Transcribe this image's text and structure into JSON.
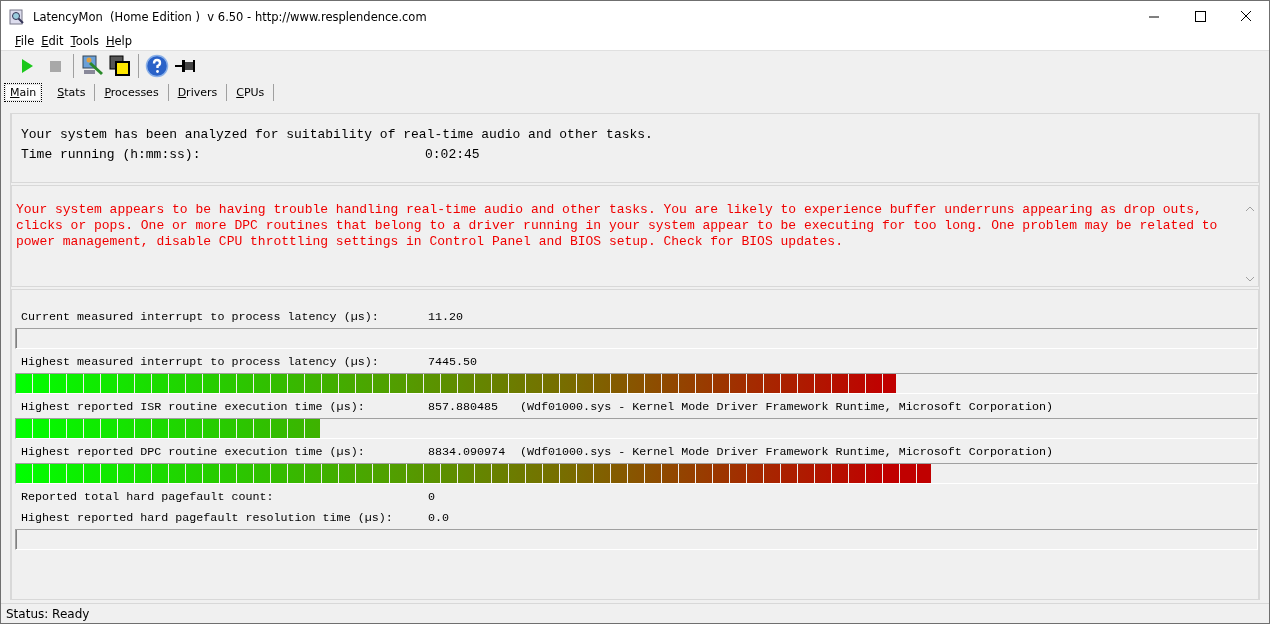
{
  "window": {
    "title": "LatencyMon  (Home Edition )  v 6.50 - http://www.resplendence.com"
  },
  "menu": [
    "File",
    "Edit",
    "Tools",
    "Help"
  ],
  "toolbar": [
    {
      "kind": "play",
      "disabled": false
    },
    {
      "kind": "stop",
      "disabled": true
    },
    {
      "kind": "monitor",
      "disabled": false
    },
    {
      "kind": "windows",
      "disabled": false
    },
    {
      "kind": "help",
      "disabled": false
    },
    {
      "kind": "pin",
      "disabled": false
    }
  ],
  "tabs": [
    {
      "label": "Main",
      "selected": true
    },
    {
      "label": "Stats",
      "selected": false
    },
    {
      "label": "Processes",
      "selected": false
    },
    {
      "label": "Drivers",
      "selected": false
    },
    {
      "label": "CPUs",
      "selected": false
    }
  ],
  "summary": {
    "message": "Your system has been analyzed for suitability of real-time audio and other tasks.",
    "time_label": "Time running (h:mm:ss):",
    "time_value": "0:02:45"
  },
  "warning": "Your system appears to be having trouble handling real-time audio and other tasks. You are likely to experience buffer underruns appearing as drop outs, clicks or pops. One or more DPC routines that belong to a driver running in your system appear to be executing for too long. One problem may be related to power management, disable CPU throttling settings in Control Panel and BIOS setup. Check for BIOS updates.",
  "metrics": [
    {
      "kind": "meter",
      "label": "Current measured interrupt to process latency (µs):",
      "value": "11.20",
      "level": 0
    },
    {
      "kind": "meter",
      "label": "Highest measured interrupt to process latency (µs):",
      "value": "7445.50",
      "level": 0.709
    },
    {
      "kind": "meter",
      "label": "Highest reported ISR routine execution time (µs):",
      "value": "857.880485",
      "detail": "(Wdf01000.sys - Kernel Mode Driver Framework Runtime, Microsoft Corporation)",
      "level": 0.245
    },
    {
      "kind": "meter",
      "label": "Highest reported DPC routine execution time (µs):",
      "value": "8834.090974",
      "detail": "(Wdf01000.sys - Kernel Mode Driver Framework Runtime, Microsoft Corporation)",
      "level": 0.737
    },
    {
      "kind": "text",
      "label": "Reported total hard pagefault count:",
      "value": "0"
    },
    {
      "kind": "meter",
      "label": "Highest reported hard pagefault resolution time (µs):",
      "value": "0.0",
      "level": 0
    }
  ],
  "status_bar": "Status: Ready"
}
